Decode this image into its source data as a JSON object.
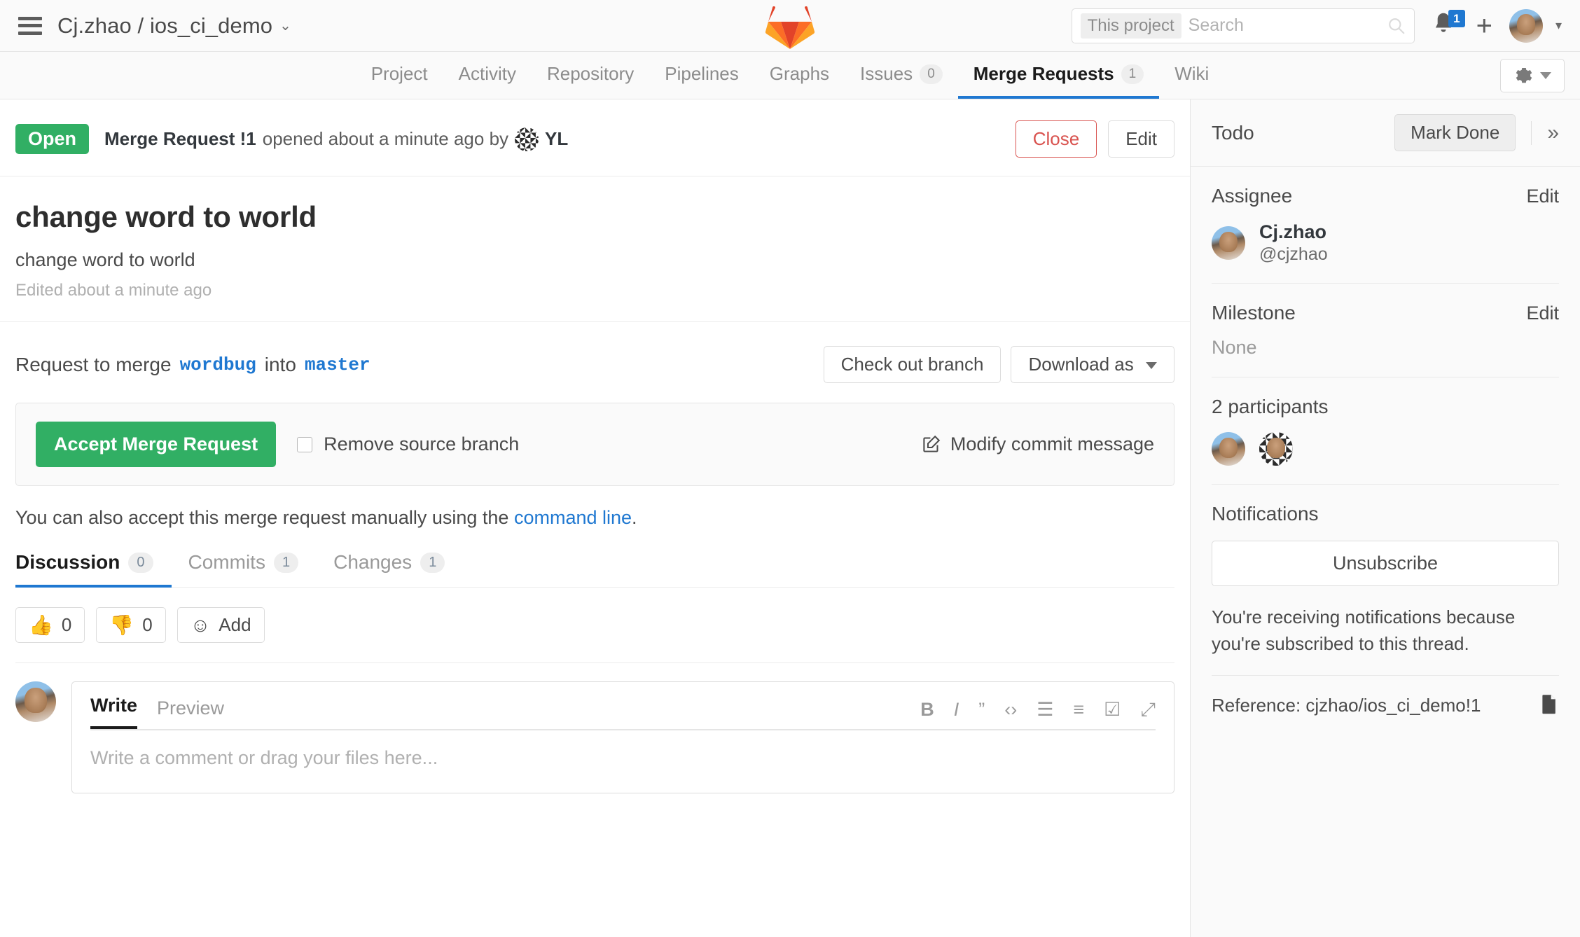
{
  "topbar": {
    "menu_icon": "hamburger-icon",
    "project_path": "Cj.zhao / ios_ci_demo",
    "project_caret": "⌄",
    "logo": "gitlab-logo",
    "search": {
      "scope": "This project",
      "placeholder": "Search",
      "value": ""
    },
    "notifications_count": "1",
    "new_label": "+",
    "user_caret": "▾"
  },
  "nav": {
    "items": [
      {
        "label": "Project",
        "count": null,
        "active": false
      },
      {
        "label": "Activity",
        "count": null,
        "active": false
      },
      {
        "label": "Repository",
        "count": null,
        "active": false
      },
      {
        "label": "Pipelines",
        "count": null,
        "active": false
      },
      {
        "label": "Graphs",
        "count": null,
        "active": false
      },
      {
        "label": "Issues",
        "count": "0",
        "active": false
      },
      {
        "label": "Merge Requests",
        "count": "1",
        "active": true
      },
      {
        "label": "Wiki",
        "count": null,
        "active": false
      }
    ],
    "settings_icon": "gear-icon"
  },
  "mr": {
    "state": "Open",
    "meta_prefix": "Merge Request !1",
    "meta_suffix": "opened about a minute ago by",
    "author": "YL",
    "close_label": "Close",
    "edit_label": "Edit",
    "title": "change word to world",
    "description": "change word to world",
    "edited": "Edited about a minute ago",
    "merge_request_text": "Request to merge",
    "source_branch": "wordbug",
    "into_text": "into",
    "target_branch": "master",
    "checkout_label": "Check out branch",
    "download_label": "Download as",
    "accept_label": "Accept Merge Request",
    "remove_source_label": "Remove source branch",
    "remove_source_checked": false,
    "modify_commit_label": "Modify commit message",
    "manual_prefix": "You can also accept this merge request manually using the",
    "manual_link": "command line",
    "manual_suffix": "."
  },
  "tabs": [
    {
      "label": "Discussion",
      "count": "0",
      "active": true
    },
    {
      "label": "Commits",
      "count": "1",
      "active": false
    },
    {
      "label": "Changes",
      "count": "1",
      "active": false
    }
  ],
  "awards": [
    {
      "icon": "thumbs-up-emoji",
      "glyph": "👍",
      "count": "0"
    },
    {
      "icon": "thumbs-down-emoji",
      "glyph": "👎",
      "count": "0"
    },
    {
      "icon": "smiley-add-emoji",
      "glyph": "☺",
      "count": "Add"
    }
  ],
  "comment": {
    "write_tab": "Write",
    "preview_tab": "Preview",
    "placeholder": "Write a comment or drag your files here...",
    "tools": [
      {
        "name": "bold-icon",
        "glyph": "B"
      },
      {
        "name": "italic-icon",
        "glyph": "I"
      },
      {
        "name": "quote-icon",
        "glyph": "”"
      },
      {
        "name": "code-icon",
        "glyph": "‹›"
      },
      {
        "name": "bullet-list-icon",
        "glyph": "☰"
      },
      {
        "name": "numbered-list-icon",
        "glyph": "≡"
      },
      {
        "name": "task-list-icon",
        "glyph": "☑"
      },
      {
        "name": "fullscreen-icon",
        "glyph": "⤢"
      }
    ]
  },
  "sidebar": {
    "todo_label": "Todo",
    "mark_done_label": "Mark Done",
    "expand_icon": "»",
    "assignee": {
      "title": "Assignee",
      "edit": "Edit",
      "name": "Cj.zhao",
      "handle": "@cjzhao"
    },
    "milestone": {
      "title": "Milestone",
      "edit": "Edit",
      "value": "None"
    },
    "participants": {
      "title": "2 participants"
    },
    "notifications": {
      "title": "Notifications",
      "button": "Unsubscribe",
      "description": "You're receiving notifications because you're subscribed to this thread."
    },
    "reference": {
      "text": "Reference: cjzhao/ios_ci_demo!1",
      "copy_icon": "copy-icon"
    }
  },
  "colors": {
    "accent_blue": "#1f78d1",
    "success_green": "#31af64",
    "danger_red": "#d9534f",
    "gitlab_orange": "#e24329"
  }
}
